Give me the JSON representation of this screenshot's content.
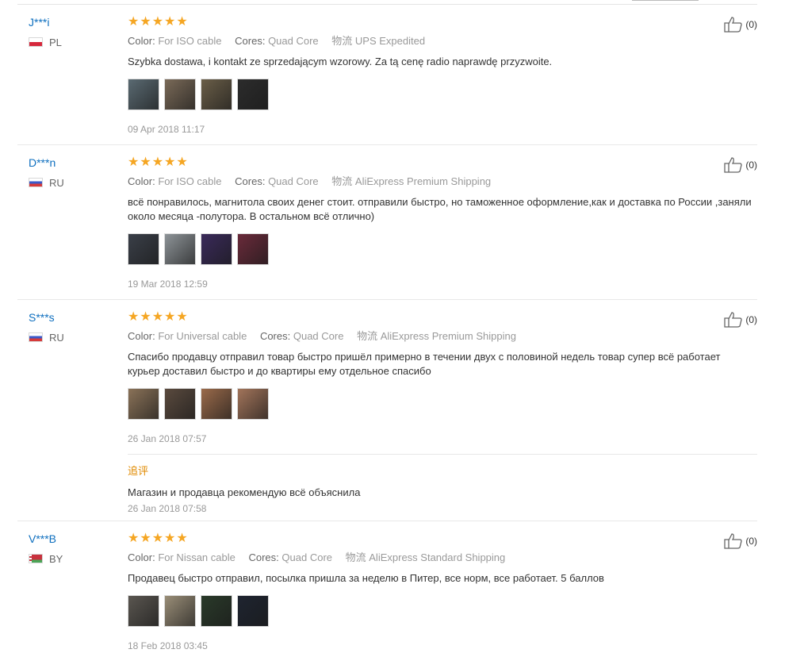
{
  "labels": {
    "color": "Color:",
    "cores": "Cores:",
    "logistics": "物流",
    "followup": "追评"
  },
  "reviews": [
    {
      "user": "J***i",
      "country": "PL",
      "flag": "pl",
      "stars": "★★★★★",
      "color": "For ISO cable",
      "cores": "Quad Core",
      "shipping": "UPS Expedited",
      "text": "Szybka dostawa, i kontakt ze sprzedającym wzorowy. Za tą cenę radio naprawdę przyzwoite.",
      "thumbs": [
        "#5a6a72",
        "#7a6a58",
        "#6a5e48",
        "#2c2c2c"
      ],
      "date": "09 Apr 2018 11:17",
      "likes": "(0)"
    },
    {
      "user": "D***n",
      "country": "RU",
      "flag": "ru",
      "stars": "★★★★★",
      "color": "For ISO cable",
      "cores": "Quad Core",
      "shipping": "AliExpress Premium Shipping",
      "text": "всё понравилось, магнитола своих денег стоит. отправили быстро, но таможенное оформление,как и доставка по России ,заняли около месяца -полутора. В остальном всё отлично)",
      "thumbs": [
        "#3a3f48",
        "#8e9498",
        "#3a2a5a",
        "#6a2a3a"
      ],
      "date": "19 Mar 2018 12:59",
      "likes": "(0)"
    },
    {
      "user": "S***s",
      "country": "RU",
      "flag": "ru",
      "stars": "★★★★★",
      "color": "For Universal cable",
      "cores": "Quad Core",
      "shipping": "AliExpress Premium Shipping",
      "text": "Спасибо продавцу отправил товар быстро пришёл примерно в течении двух с половиной недель товар супер всё работает курьер доставил быстро и до квартиры ему отдельное спасибо",
      "thumbs": [
        "#8a7258",
        "#5a4a3e",
        "#9a6a4a",
        "#a2745a"
      ],
      "date": "26 Jan 2018 07:57",
      "followup_text": "Магазин и продавца рекомендую всё объяснила",
      "followup_date": "26 Jan 2018 07:58",
      "likes": "(0)"
    },
    {
      "user": "V***B",
      "country": "BY",
      "flag": "by",
      "stars": "★★★★★",
      "color": "For Nissan cable",
      "cores": "Quad Core",
      "shipping": "AliExpress Standard Shipping",
      "text": "Продавец быстро отправил, посылка пришла за неделю в Питер, все норм, все работает. 5 баллов",
      "thumbs": [
        "#5a5650",
        "#9a8e78",
        "#2a3a2a",
        "#1e2430"
      ],
      "date": "18 Feb 2018 03:45",
      "likes": "(0)"
    }
  ]
}
